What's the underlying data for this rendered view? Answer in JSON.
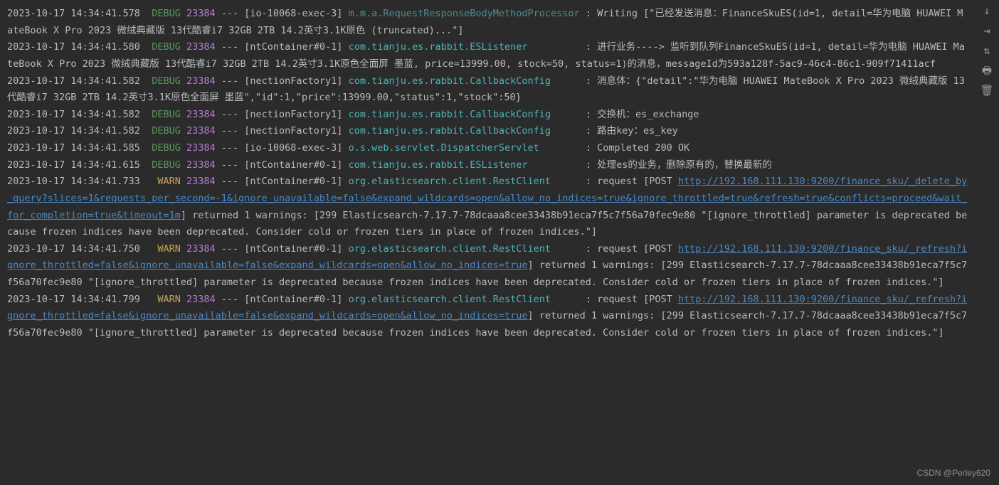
{
  "watermark": "CSDN @Perley620",
  "toolbar": {
    "download": "↓",
    "wrap": "⇥",
    "scroll": "⇅",
    "print": "🖶",
    "trash": "🗑"
  },
  "entries": [
    {
      "ts": "2023-10-17 14:34:41.578",
      "level": "DEBUG",
      "pid": "23384",
      "thread": "[io-10068-exec-3]",
      "logger": "m.m.a.RequestResponseBodyMethodProcessor",
      "loggerClass": "logger-mma",
      "msg": "Writing [\"已经发送消息：FinanceSkuES(id=1, detail=华为电脑 HUAWEI MateBook X Pro 2023 微绒典藏版 13代酷睿i7 32GB 2TB 14.2英寸3.1K原色 (truncated)...\"]"
    },
    {
      "ts": "2023-10-17 14:34:41.580",
      "level": "DEBUG",
      "pid": "23384",
      "thread": "[ntContainer#0-1]",
      "logger": "com.tianju.es.rabbit.ESListener",
      "loggerClass": "logger-cyan",
      "msg": "进行业务----> 监听到队列FinanceSkuES(id=1, detail=华为电脑 HUAWEI MateBook X Pro 2023 微绒典藏版 13代酷睿i7 32GB 2TB 14.2英寸3.1K原色全面屏 墨蓝, price=13999.00, stock=50, status=1)的消息，messageId为593a128f-5ac9-46c4-86c1-909f71411acf"
    },
    {
      "ts": "2023-10-17 14:34:41.582",
      "level": "DEBUG",
      "pid": "23384",
      "thread": "[nectionFactory1]",
      "logger": "com.tianju.es.rabbit.CallbackConfig",
      "loggerClass": "logger-cyan",
      "msg": "消息体：{\"detail\":\"华为电脑 HUAWEI MateBook X Pro 2023 微绒典藏版 13代酷睿i7 32GB 2TB 14.2英寸3.1K原色全面屏 墨蓝\",\"id\":1,\"price\":13999.00,\"status\":1,\"stock\":50}"
    },
    {
      "ts": "2023-10-17 14:34:41.582",
      "level": "DEBUG",
      "pid": "23384",
      "thread": "[nectionFactory1]",
      "logger": "com.tianju.es.rabbit.CallbackConfig",
      "loggerClass": "logger-cyan",
      "msg": "交换机：es_exchange"
    },
    {
      "ts": "2023-10-17 14:34:41.582",
      "level": "DEBUG",
      "pid": "23384",
      "thread": "[nectionFactory1]",
      "logger": "com.tianju.es.rabbit.CallbackConfig",
      "loggerClass": "logger-cyan",
      "msg": "路由key：es_key"
    },
    {
      "ts": "2023-10-17 14:34:41.585",
      "level": "DEBUG",
      "pid": "23384",
      "thread": "[io-10068-exec-3]",
      "logger": "o.s.web.servlet.DispatcherServlet",
      "loggerClass": "logger-cyan",
      "msg": "Completed 200 OK"
    },
    {
      "ts": "2023-10-17 14:34:41.615",
      "level": "DEBUG",
      "pid": "23384",
      "thread": "[ntContainer#0-1]",
      "logger": "com.tianju.es.rabbit.ESListener",
      "loggerClass": "logger-cyan",
      "msg": "处理es的业务，删除原有的，替换最新的"
    },
    {
      "ts": "2023-10-17 14:34:41.733",
      "level": "WARN",
      "pid": "23384",
      "thread": "[ntContainer#0-1]",
      "logger": "org.elasticsearch.client.RestClient",
      "loggerClass": "logger-cyan",
      "msgPre": "request [POST ",
      "url": "http://192.168.111.130:9200/finance_sku/_delete_by_query?slices=1&requests_per_second=-1&ignore_unavailable=false&expand_wildcards=open&allow_no_indices=true&ignore_throttled=true&refresh=true&conflicts=proceed&wait_for_completion=true&timeout=1m",
      "msgPost": "] returned 1 warnings: [299 Elasticsearch-7.17.7-78dcaaa8cee33438b91eca7f5c7f56a70fec9e80 \"[ignore_throttled] parameter is deprecated because frozen indices have been deprecated. Consider cold or frozen tiers in place of frozen indices.\"]"
    },
    {
      "ts": "2023-10-17 14:34:41.750",
      "level": "WARN",
      "pid": "23384",
      "thread": "[ntContainer#0-1]",
      "logger": "org.elasticsearch.client.RestClient",
      "loggerClass": "logger-cyan",
      "msgPre": "request [POST ",
      "url": "http://192.168.111.130:9200/finance_sku/_refresh?ignore_throttled=false&ignore_unavailable=false&expand_wildcards=open&allow_no_indices=true",
      "msgPost": "] returned 1 warnings: [299 Elasticsearch-7.17.7-78dcaaa8cee33438b91eca7f5c7f56a70fec9e80 \"[ignore_throttled] parameter is deprecated because frozen indices have been deprecated. Consider cold or frozen tiers in place of frozen indices.\"]"
    },
    {
      "ts": "2023-10-17 14:34:41.799",
      "level": "WARN",
      "pid": "23384",
      "thread": "[ntContainer#0-1]",
      "logger": "org.elasticsearch.client.RestClient",
      "loggerClass": "logger-cyan",
      "msgPre": "request [POST ",
      "url": "http://192.168.111.130:9200/finance_sku/_refresh?ignore_throttled=false&ignore_unavailable=false&expand_wildcards=open&allow_no_indices=true",
      "msgPost": "] returned 1 warnings: [299 Elasticsearch-7.17.7-78dcaaa8cee33438b91eca7f5c7f56a70fec9e80 \"[ignore_throttled] parameter is deprecated because frozen indices have been deprecated. Consider cold or frozen tiers in place of frozen indices.\"]"
    }
  ]
}
